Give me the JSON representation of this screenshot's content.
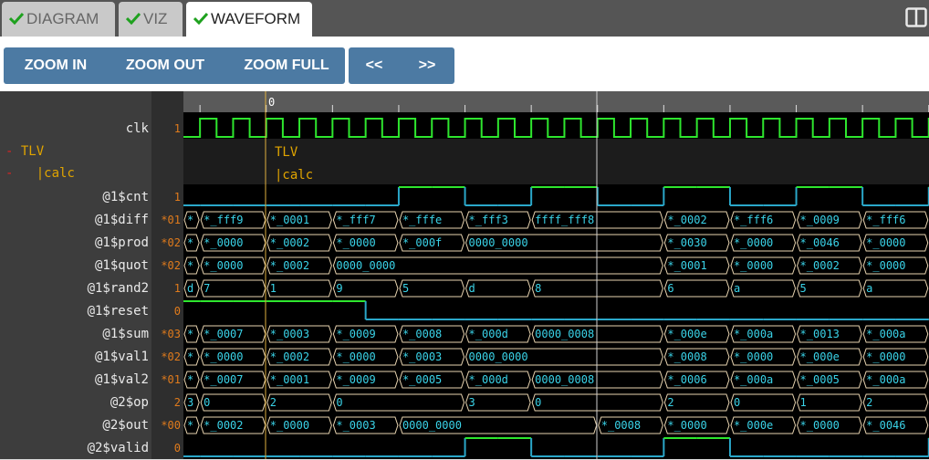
{
  "tabs": [
    {
      "label": "DIAGRAM",
      "active": false
    },
    {
      "label": "VIZ",
      "active": false
    },
    {
      "label": "WAVEFORM",
      "active": true
    }
  ],
  "toolbar": {
    "zoom_in": "ZOOM IN",
    "zoom_out": "ZOOM OUT",
    "zoom_full": "ZOOM FULL",
    "prev": "<<",
    "next": ">>"
  },
  "colors": {
    "check": "#1fa11f",
    "toolbar_button": "#4c7aa3",
    "wave_low": "#2aa7c9",
    "wave_high": "#2ee62e",
    "bus_text": "#3ad3e8",
    "bus_outline": "#e8d4b0",
    "scope_text": "#e0a400",
    "signal_value": "#e07b1c"
  },
  "timeline": {
    "marker_label": "0"
  },
  "scopes": [
    {
      "dash": "-",
      "label": "TLV",
      "wave_label": "TLV"
    },
    {
      "dash": "-",
      "label": "|calc",
      "wave_label": "|calc"
    }
  ],
  "signals": [
    {
      "name": "clk",
      "value": "1"
    },
    {
      "name": "@1$cnt",
      "value": "1"
    },
    {
      "name": "@1$diff",
      "value": "*01"
    },
    {
      "name": "@1$prod",
      "value": "*02"
    },
    {
      "name": "@1$quot",
      "value": "*02"
    },
    {
      "name": "@1$rand2",
      "value": "1"
    },
    {
      "name": "@1$reset",
      "value": "0"
    },
    {
      "name": "@1$sum",
      "value": "*03"
    },
    {
      "name": "@1$val1",
      "value": "*02"
    },
    {
      "name": "@1$val2",
      "value": "*01"
    },
    {
      "name": "@2$op",
      "value": "2"
    },
    {
      "name": "@2$out",
      "value": "*00"
    },
    {
      "name": "@2$valid",
      "value": "0"
    }
  ],
  "waves": {
    "cnt_levels": [
      0,
      0,
      0,
      0,
      0,
      0,
      1,
      1,
      0,
      0,
      1,
      1,
      0,
      0,
      1,
      1,
      0,
      0,
      1,
      1,
      0,
      0,
      1,
      1,
      0,
      0
    ],
    "valid_levels": [
      0,
      0,
      0,
      0,
      0,
      0,
      0,
      0,
      1,
      1,
      0,
      0,
      0,
      0,
      1,
      1,
      0,
      0,
      0,
      0,
      0,
      0,
      1,
      1,
      0,
      0
    ],
    "reset_levels": [
      1,
      1,
      1,
      1,
      1,
      0,
      0,
      0,
      0,
      0,
      0,
      0,
      0,
      0,
      0,
      0,
      0,
      0,
      0,
      0,
      0,
      0,
      0,
      0,
      0,
      0
    ],
    "diff": [
      [
        0,
        1,
        "*"
      ],
      [
        1,
        5,
        "*_fff9"
      ],
      [
        5,
        9,
        "*_0001"
      ],
      [
        9,
        13,
        "*_fff7"
      ],
      [
        13,
        17,
        "*_fffe"
      ],
      [
        17,
        21,
        "*_fff3"
      ],
      [
        21,
        29,
        "ffff_fff8"
      ],
      [
        29,
        33,
        "*_0002"
      ],
      [
        33,
        37,
        "*_fff6"
      ],
      [
        37,
        41,
        "*_0009"
      ],
      [
        41,
        45,
        "*_fff6"
      ],
      [
        45,
        46,
        ""
      ]
    ],
    "prod": [
      [
        0,
        1,
        "*"
      ],
      [
        1,
        5,
        "*_0000"
      ],
      [
        5,
        9,
        "*_0002"
      ],
      [
        9,
        13,
        "*_0000"
      ],
      [
        13,
        17,
        "*_000f"
      ],
      [
        17,
        29,
        "0000_0000"
      ],
      [
        29,
        33,
        "*_0030"
      ],
      [
        33,
        37,
        "*_0000"
      ],
      [
        37,
        41,
        "*_0046"
      ],
      [
        41,
        45,
        "*_0000"
      ],
      [
        45,
        46,
        ""
      ]
    ],
    "quot": [
      [
        0,
        1,
        "*"
      ],
      [
        1,
        5,
        "*_0000"
      ],
      [
        5,
        9,
        "*_0002"
      ],
      [
        9,
        29,
        "0000_0000"
      ],
      [
        29,
        33,
        "*_0001"
      ],
      [
        33,
        37,
        "*_0000"
      ],
      [
        37,
        41,
        "*_0002"
      ],
      [
        41,
        45,
        "*_0000"
      ],
      [
        45,
        46,
        ""
      ]
    ],
    "rand2": [
      [
        0,
        1,
        "d"
      ],
      [
        1,
        5,
        "7"
      ],
      [
        5,
        9,
        "1"
      ],
      [
        9,
        13,
        "9"
      ],
      [
        13,
        17,
        "5"
      ],
      [
        17,
        21,
        "d"
      ],
      [
        21,
        29,
        "8"
      ],
      [
        29,
        33,
        "6"
      ],
      [
        33,
        37,
        "a"
      ],
      [
        37,
        41,
        "5"
      ],
      [
        41,
        45,
        "a"
      ],
      [
        45,
        46,
        ""
      ]
    ],
    "sum": [
      [
        0,
        1,
        "*"
      ],
      [
        1,
        5,
        "*_0007"
      ],
      [
        5,
        9,
        "*_0003"
      ],
      [
        9,
        13,
        "*_0009"
      ],
      [
        13,
        17,
        "*_0008"
      ],
      [
        17,
        21,
        "*_000d"
      ],
      [
        21,
        29,
        "0000_0008"
      ],
      [
        29,
        33,
        "*_000e"
      ],
      [
        33,
        37,
        "*_000a"
      ],
      [
        37,
        41,
        "*_0013"
      ],
      [
        41,
        45,
        "*_000a"
      ],
      [
        45,
        46,
        ""
      ]
    ],
    "val1": [
      [
        0,
        1,
        "*"
      ],
      [
        1,
        5,
        "*_0000"
      ],
      [
        5,
        9,
        "*_0002"
      ],
      [
        9,
        13,
        "*_0000"
      ],
      [
        13,
        17,
        "*_0003"
      ],
      [
        17,
        29,
        "0000_0000"
      ],
      [
        29,
        33,
        "*_0008"
      ],
      [
        33,
        37,
        "*_0000"
      ],
      [
        37,
        41,
        "*_000e"
      ],
      [
        41,
        45,
        "*_0000"
      ],
      [
        45,
        46,
        ""
      ]
    ],
    "val2": [
      [
        0,
        1,
        "*"
      ],
      [
        1,
        5,
        "*_0007"
      ],
      [
        5,
        9,
        "*_0001"
      ],
      [
        9,
        13,
        "*_0009"
      ],
      [
        13,
        17,
        "*_0005"
      ],
      [
        17,
        21,
        "*_000d"
      ],
      [
        21,
        29,
        "0000_0008"
      ],
      [
        29,
        33,
        "*_0006"
      ],
      [
        33,
        37,
        "*_000a"
      ],
      [
        37,
        41,
        "*_0005"
      ],
      [
        41,
        45,
        "*_000a"
      ],
      [
        45,
        46,
        ""
      ]
    ],
    "op": [
      [
        0,
        1,
        "3"
      ],
      [
        1,
        5,
        "0"
      ],
      [
        5,
        9,
        "2"
      ],
      [
        9,
        17,
        "0"
      ],
      [
        17,
        21,
        "3"
      ],
      [
        21,
        29,
        "0"
      ],
      [
        29,
        33,
        "2"
      ],
      [
        33,
        37,
        "0"
      ],
      [
        37,
        41,
        "1"
      ],
      [
        41,
        45,
        "2"
      ],
      [
        45,
        46,
        ""
      ]
    ],
    "out": [
      [
        0,
        1,
        "*"
      ],
      [
        1,
        5,
        "*_0002"
      ],
      [
        5,
        9,
        "*_0000"
      ],
      [
        9,
        13,
        "*_0003"
      ],
      [
        13,
        25,
        "0000_0000"
      ],
      [
        25,
        29,
        "*_0008"
      ],
      [
        29,
        33,
        "*_0000"
      ],
      [
        33,
        37,
        "*_000e"
      ],
      [
        37,
        41,
        "*_0000"
      ],
      [
        41,
        45,
        "*_0046"
      ],
      [
        45,
        46,
        ""
      ]
    ]
  }
}
